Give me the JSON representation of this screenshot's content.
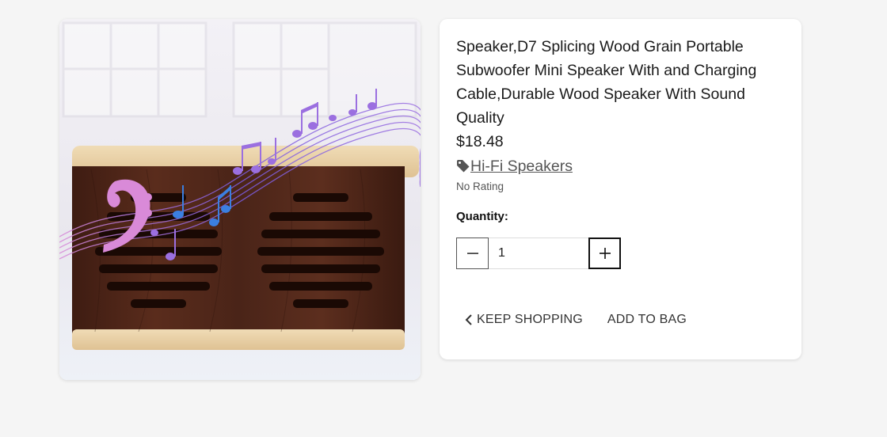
{
  "product": {
    "title": "Speaker,D7 Splicing Wood Grain Portable Subwoofer Mini Speaker With and Charging Cable,Durable Wood Speaker With Sound Quality",
    "price": "$18.48",
    "category": "Hi-Fi Speakers",
    "category_icon": "tag-icon",
    "rating": "No Rating",
    "image_alt": "Wooden portable speaker with music notes"
  },
  "quantity": {
    "label": "Quantity:",
    "value": "1",
    "decrement_icon": "minus-icon",
    "increment_icon": "plus-icon"
  },
  "actions": {
    "keep_shopping": "KEEP SHOPPING",
    "keep_shopping_icon": "chevron-left-icon",
    "add_to_bag": "ADD TO BAG"
  },
  "colors": {
    "page_bg": "#f5f5f5",
    "card_bg": "#ffffff",
    "wood_dark": "#4a2418",
    "wood_light": "#e8cfa4",
    "note_purple": "#9b6fe0",
    "note_blue": "#3b7fe0",
    "note_pink": "#d98ad8"
  }
}
